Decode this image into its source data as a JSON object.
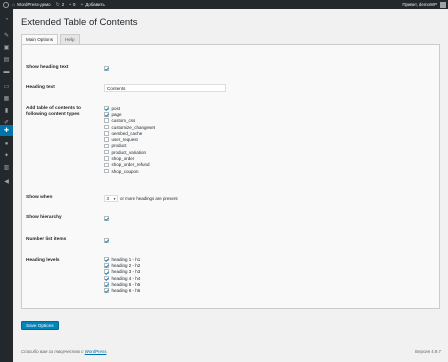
{
  "admin_bar": {
    "site_name": "WordPress-демо",
    "updates_count": "2",
    "comments_count": "0",
    "new_label": "Добавить",
    "greeting": "Привет, demoWP"
  },
  "side_menu_icons": [
    "dashboard-icon",
    "pin-icon",
    "media-icon",
    "pages-icon",
    "comments-icon",
    "woocommerce-icon",
    "products-icon",
    "analytics-icon",
    "appearance-icon",
    "plugins-icon",
    "users-icon",
    "tools-icon",
    "settings-icon",
    "collapse-icon"
  ],
  "page": {
    "title": "Extended Table of Contents",
    "tabs": [
      "Main Options",
      "Help"
    ],
    "fields": {
      "show_heading_text": {
        "label": "Show heading text",
        "checked": true
      },
      "heading_text": {
        "label": "Heading text",
        "value": "Contents"
      },
      "content_types": {
        "label": "Add table of contents to following content types",
        "options": [
          {
            "label": "post",
            "checked": true
          },
          {
            "label": "page",
            "checked": true
          },
          {
            "label": "custom_css",
            "checked": false
          },
          {
            "label": "customize_changeset",
            "checked": false
          },
          {
            "label": "oembed_cache",
            "checked": false
          },
          {
            "label": "user_request",
            "checked": false
          },
          {
            "label": "product",
            "checked": false
          },
          {
            "label": "product_variation",
            "checked": false
          },
          {
            "label": "shop_order",
            "checked": false
          },
          {
            "label": "shop_order_refund",
            "checked": false
          },
          {
            "label": "shop_coupon",
            "checked": false
          }
        ]
      },
      "show_when": {
        "label": "Show when",
        "value": "3",
        "suffix": "or more headings are present"
      },
      "show_hierarchy": {
        "label": "Show hierarchy",
        "checked": true
      },
      "number_list_items": {
        "label": "Number list items",
        "checked": true
      },
      "heading_levels": {
        "label": "Heading levels",
        "options": [
          {
            "label": "heading 1 - h1",
            "checked": true
          },
          {
            "label": "heading 2 - h2",
            "checked": true
          },
          {
            "label": "heading 3 - h3",
            "checked": true
          },
          {
            "label": "heading 4 - h4",
            "checked": true
          },
          {
            "label": "heading 5 - h5",
            "checked": true
          },
          {
            "label": "heading 6 - h6",
            "checked": true
          }
        ]
      }
    },
    "save_label": "Save Options"
  },
  "footer": {
    "thanks_text": "Спасибо вам за творчество с",
    "thanks_link": "WordPress",
    "thanks_end": ".",
    "version": "Версия 4.9.7"
  }
}
